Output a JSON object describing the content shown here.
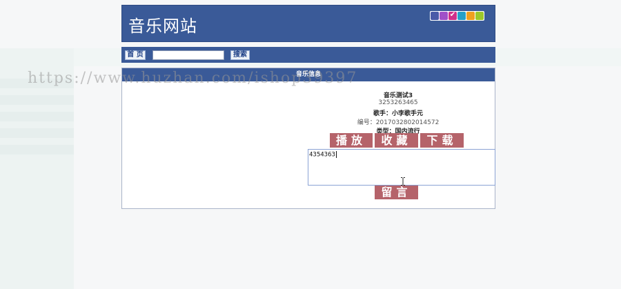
{
  "header": {
    "site_title": "音乐网站",
    "theme_swatches": [
      {
        "color": "#4a5aa8",
        "selected": false
      },
      {
        "color": "#a050c8",
        "selected": false
      },
      {
        "color": "#d0308a",
        "selected": true
      },
      {
        "color": "#26a0c8",
        "selected": false
      },
      {
        "color": "#f0a020",
        "selected": false
      },
      {
        "color": "#9cc82a",
        "selected": false
      }
    ]
  },
  "nav": {
    "home_label": "首 页",
    "search_value": "",
    "search_button_label": "搜索"
  },
  "watermark": "https://www.huzhan.com/ishop39397",
  "panel": {
    "title": "音乐信息",
    "song_title": "音乐测试3",
    "song_number": "3253263465",
    "singer": "歌手：小李歌手元",
    "code": "编号：2017032802014572",
    "type": "类型：国内流行",
    "buttons": {
      "play": "播放",
      "favorite": "收藏",
      "download": "下载",
      "message": "留言"
    },
    "comment_value": "4354363"
  },
  "icons": {
    "selected_swatch": "check-icon",
    "mouse": "text-cursor-icon"
  }
}
